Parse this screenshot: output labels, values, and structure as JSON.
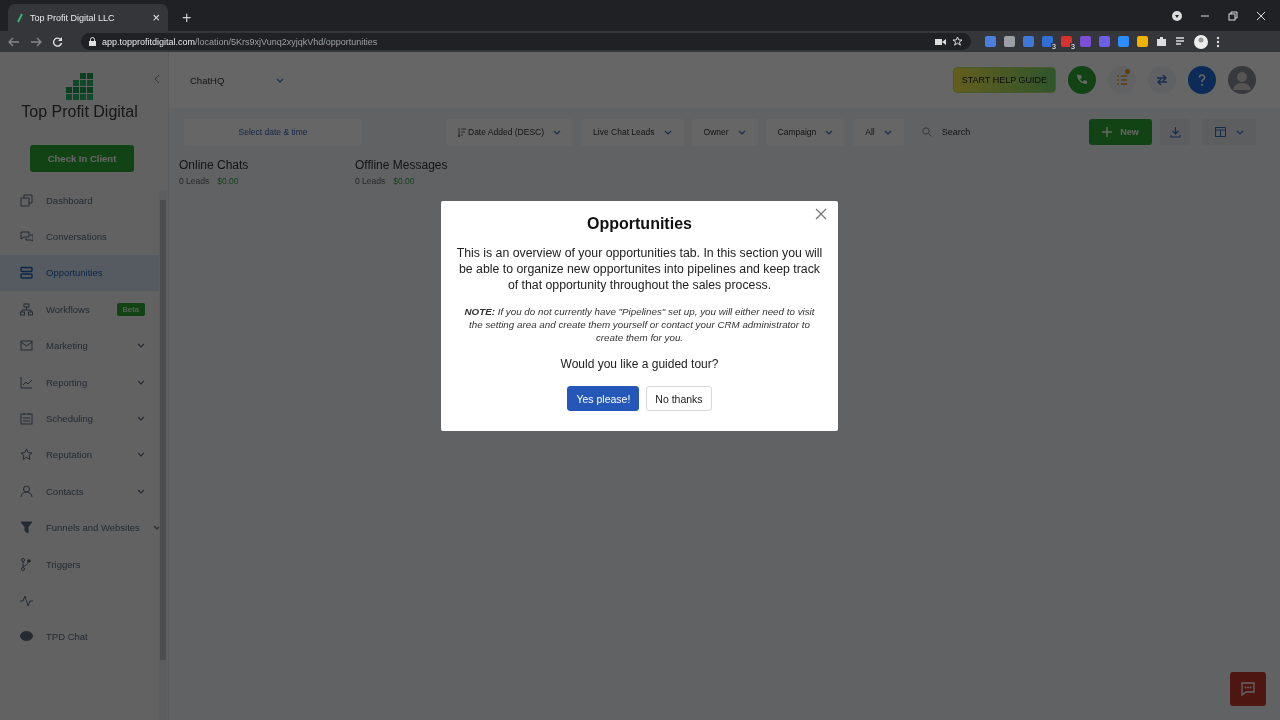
{
  "browser": {
    "tab_title": "Top Profit Digital LLC",
    "tab_close": "×",
    "new_tab": "+",
    "url_host": "app.topprofitdigital.com",
    "url_path": "/location/5Krs9xjVunq2xyjqkVhd/opportunities",
    "extensions": [
      {
        "color": "#4a7fe0"
      },
      {
        "color": "#9aa0a6"
      },
      {
        "color": "#3c79d8"
      },
      {
        "color": "#2f6fd6",
        "badge": "3"
      },
      {
        "color": "#d93030",
        "badge": "3"
      },
      {
        "color": "#7b4fd8"
      },
      {
        "color": "#6b5fe8"
      },
      {
        "color": "#2d8cff"
      },
      {
        "color": "#f0b400"
      }
    ]
  },
  "sidebar": {
    "brand": "Top Profit Digital",
    "check_in": "Check In Client",
    "items": [
      {
        "label": "Dashboard",
        "selected": false,
        "expandable": false
      },
      {
        "label": "Conversations",
        "selected": false,
        "expandable": false
      },
      {
        "label": "Opportunities",
        "selected": true,
        "expandable": false
      },
      {
        "label": "Workflows",
        "selected": false,
        "expandable": false,
        "badge": "Beta"
      },
      {
        "label": "Marketing",
        "selected": false,
        "expandable": true
      },
      {
        "label": "Reporting",
        "selected": false,
        "expandable": true
      },
      {
        "label": "Scheduling",
        "selected": false,
        "expandable": true
      },
      {
        "label": "Reputation",
        "selected": false,
        "expandable": true
      },
      {
        "label": "Contacts",
        "selected": false,
        "expandable": true
      },
      {
        "label": "Funnels and Websites",
        "selected": false,
        "expandable": true
      },
      {
        "label": "Triggers",
        "selected": false,
        "expandable": false
      },
      {
        "selected": false,
        "expandable": false
      },
      {
        "label": "TPD Chat",
        "selected": false,
        "expandable": false
      }
    ]
  },
  "header": {
    "account": "ChatHQ",
    "help_guide": "START HELP GUIDE"
  },
  "filters": {
    "date_placeholder": "Select date & time",
    "dropdowns": [
      {
        "label": "Date Added (DESC)",
        "kind": "sort"
      },
      {
        "label": "Live Chat Leads",
        "kind": "plain"
      },
      {
        "label": "Owner",
        "kind": "plain"
      },
      {
        "label": "Campaign",
        "kind": "plain"
      },
      {
        "label": "All",
        "kind": "plain"
      }
    ],
    "search_placeholder": "Search",
    "new_button": "New"
  },
  "board": {
    "columns": [
      {
        "title": "Online Chats",
        "count": "0 Leads",
        "amount": "$0.00"
      },
      {
        "title": "Offline Messages",
        "count": "0 Leads",
        "amount": "$0.00"
      }
    ]
  },
  "modal": {
    "title": "Opportunities",
    "body": "This is an overview of your opportunities tab. In this section you will be able to organize new opportunites into pipelines and keep track of that opportunity throughout the sales process.",
    "note": "**NOTE:** If you do not currently have \"Pipelines\" set up, you will either need to visit the setting area and create them yourself or contact your CRM administrator to create them for you.",
    "question": "Would you like a guided tour?",
    "buttons": [
      {
        "label": "Yes please!",
        "kind": "primary"
      },
      {
        "label": "No thanks",
        "kind": "secondary"
      }
    ]
  }
}
